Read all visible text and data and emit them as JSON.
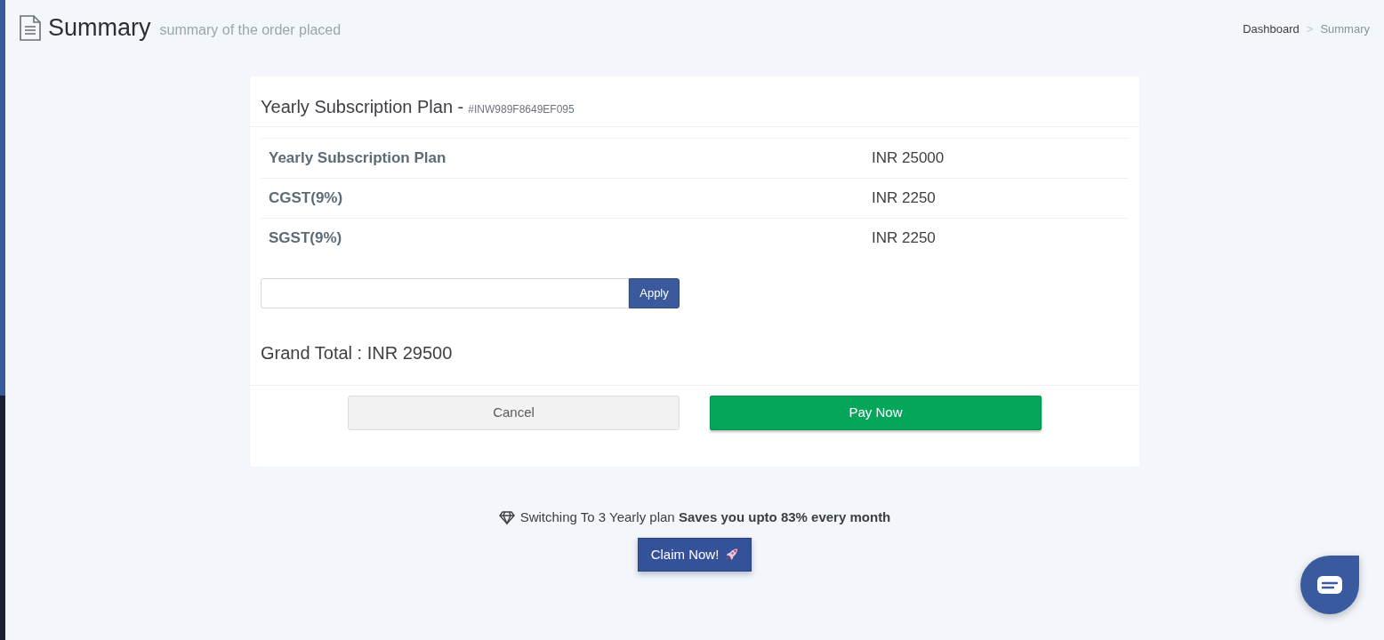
{
  "header": {
    "title": "Summary",
    "subtitle": "summary of the order placed"
  },
  "breadcrumb": {
    "separator": ">",
    "items": [
      {
        "label": "Dashboard",
        "selected": false
      },
      {
        "label": "Summary",
        "selected": true
      }
    ]
  },
  "order": {
    "title": "Yearly Subscription Plan -",
    "order_id": "#INW989F8649EF095",
    "items": [
      {
        "label": "Yearly Subscription Plan",
        "amount": "INR 25000"
      },
      {
        "label": "CGST(9%)",
        "amount": "INR 2250"
      },
      {
        "label": "SGST(9%)",
        "amount": "INR 2250"
      }
    ],
    "coupon": {
      "button": "Apply"
    },
    "grand_total": "Grand Total : INR 29500",
    "buttons": [
      {
        "label": "Cancel",
        "kind": "secondary"
      },
      {
        "label": "Pay Now",
        "kind": "primary"
      }
    ]
  },
  "promo": {
    "text": "Switching To 3 Yearly plan **Saves you upto 83% every month**",
    "button": "Claim Now!"
  }
}
